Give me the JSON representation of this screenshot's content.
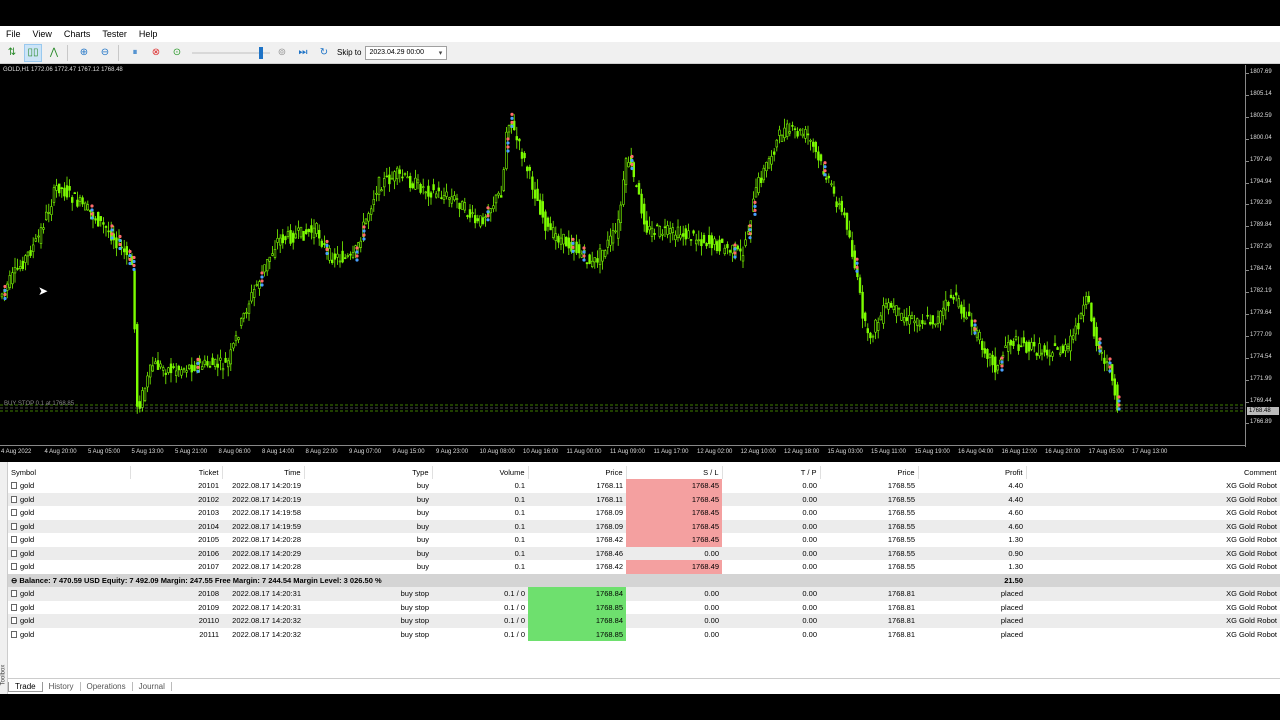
{
  "menu": [
    "File",
    "View",
    "Charts",
    "Tester",
    "Help"
  ],
  "toolbar": {
    "skip_label": "Skip to",
    "skip_date": "2023.04.29 00:00",
    "speed_level": 0.9
  },
  "chart": {
    "info": "GOLD,H1  1772.06  1772.47  1767.12  1768.48",
    "order_label": "BUY STOP 0.1 at 1768.85",
    "price_labels": [
      "1807.69",
      "1805.14",
      "1802.59",
      "1800.04",
      "1797.49",
      "1794.94",
      "1792.39",
      "1789.84",
      "1787.29",
      "1784.74",
      "1782.19",
      "1779.64",
      "1777.09",
      "1774.54",
      "1771.99",
      "1769.44",
      "1766.89"
    ],
    "current_price_tag": "1768.48",
    "time_labels": [
      "4 Aug 2022",
      "4 Aug 20:00",
      "5 Aug 05:00",
      "5 Aug 13:00",
      "5 Aug 21:00",
      "8 Aug 06:00",
      "8 Aug 14:00",
      "8 Aug 22:00",
      "9 Aug 07:00",
      "9 Aug 15:00",
      "9 Aug 23:00",
      "10 Aug 08:00",
      "10 Aug 16:00",
      "11 Aug 00:00",
      "11 Aug 09:00",
      "11 Aug 17:00",
      "12 Aug 02:00",
      "12 Aug 10:00",
      "12 Aug 18:00",
      "15 Aug 03:00",
      "15 Aug 11:00",
      "15 Aug 19:00",
      "16 Aug 04:00",
      "16 Aug 12:00",
      "16 Aug 20:00",
      "17 Aug 05:00",
      "17 Aug 13:00"
    ],
    "colors": {
      "bull": "#7cfc00",
      "bear": "#ffffff",
      "bg": "#000000"
    }
  },
  "table": {
    "headers": [
      "Symbol",
      "Ticket",
      "Time",
      "Type",
      "Volume",
      "Price",
      "S / L",
      "T / P",
      "Price",
      "Profit",
      "Comment"
    ],
    "positions": [
      [
        "gold",
        "20101",
        "2022.08.17 14:20:19",
        "buy",
        "0.1",
        "1768.11",
        "1768.45",
        "0.00",
        "1768.55",
        "4.40",
        "XG Gold Robot"
      ],
      [
        "gold",
        "20102",
        "2022.08.17 14:20:19",
        "buy",
        "0.1",
        "1768.11",
        "1768.45",
        "0.00",
        "1768.55",
        "4.40",
        "XG Gold Robot"
      ],
      [
        "gold",
        "20103",
        "2022.08.17 14:19:58",
        "buy",
        "0.1",
        "1768.09",
        "1768.45",
        "0.00",
        "1768.55",
        "4.60",
        "XG Gold Robot"
      ],
      [
        "gold",
        "20104",
        "2022.08.17 14:19:59",
        "buy",
        "0.1",
        "1768.09",
        "1768.45",
        "0.00",
        "1768.55",
        "4.60",
        "XG Gold Robot"
      ],
      [
        "gold",
        "20105",
        "2022.08.17 14:20:28",
        "buy",
        "0.1",
        "1768.42",
        "1768.45",
        "0.00",
        "1768.55",
        "1.30",
        "XG Gold Robot"
      ],
      [
        "gold",
        "20106",
        "2022.08.17 14:20:29",
        "buy",
        "0.1",
        "1768.46",
        "0.00",
        "0.00",
        "1768.55",
        "0.90",
        "XG Gold Robot"
      ],
      [
        "gold",
        "20107",
        "2022.08.17 14:20:28",
        "buy",
        "0.1",
        "1768.42",
        "1768.49",
        "0.00",
        "1768.55",
        "1.30",
        "XG Gold Robot"
      ]
    ],
    "summary": "Balance: 7 470.59 USD  Equity: 7 492.09  Margin: 247.55  Free Margin: 7 244.54  Margin Level: 3 026.50 %",
    "summary_profit": "21.50",
    "orders": [
      [
        "gold",
        "20108",
        "2022.08.17 14:20:31",
        "buy stop",
        "0.1 / 0",
        "1768.84",
        "0.00",
        "0.00",
        "1768.81",
        "placed",
        "XG Gold Robot"
      ],
      [
        "gold",
        "20109",
        "2022.08.17 14:20:31",
        "buy stop",
        "0.1 / 0",
        "1768.85",
        "0.00",
        "0.00",
        "1768.81",
        "placed",
        "XG Gold Robot"
      ],
      [
        "gold",
        "20110",
        "2022.08.17 14:20:32",
        "buy stop",
        "0.1 / 0",
        "1768.84",
        "0.00",
        "0.00",
        "1768.81",
        "placed",
        "XG Gold Robot"
      ],
      [
        "gold",
        "20111",
        "2022.08.17 14:20:32",
        "buy stop",
        "0.1 / 0",
        "1768.85",
        "0.00",
        "0.00",
        "1768.81",
        "placed",
        "XG Gold Robot"
      ]
    ]
  },
  "toolbox_label": "Toolbox",
  "tabs": [
    "Trade",
    "History",
    "Operations",
    "Journal"
  ]
}
